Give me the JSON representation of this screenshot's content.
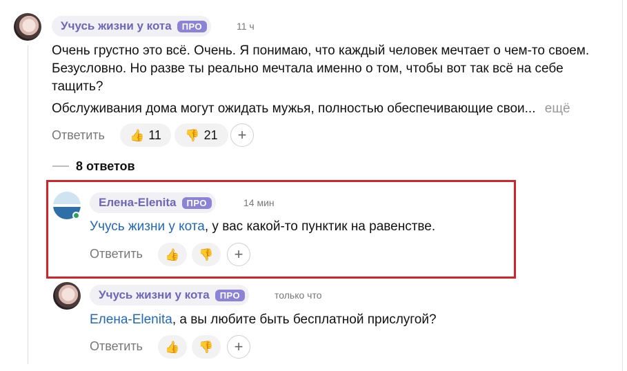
{
  "comment": {
    "author": "Учусь жизни у кота",
    "badge": "ПРО",
    "time": "11 ч",
    "paragraph1": "Очень грустно это всё. Очень. Я понимаю, что каждый человек мечтает о чем-то своем. Безусловно. Но разве ты реально мечтала именно о том, чтобы вот так всё на себе тащить?",
    "paragraph2": "Обслуживания дома могут ожидать мужья, полностью обеспечивающие свои...",
    "more_label": "ещё",
    "reply_label": "Ответить",
    "likes": "11",
    "dislikes": "21"
  },
  "replies_count_label": "8 ответов",
  "replies": [
    {
      "author": "Елена-Elenita",
      "badge": "ПРО",
      "time": "14 мин",
      "mention": "Учусь жизни у кота",
      "text": ", у вас какой-то пунктик на равенстве.",
      "reply_label": "Ответить"
    },
    {
      "author": "Учусь жизни у кота",
      "badge": "ПРО",
      "time": "только что",
      "mention": "Елена-Elenita",
      "text": ", а вы любите быть бесплатной прислугой?",
      "reply_label": "Ответить"
    }
  ],
  "icons": {
    "like": "thumbs-up-icon",
    "dislike": "thumbs-down-icon",
    "add": "plus-icon"
  },
  "colors": {
    "author": "#6e66b8",
    "pro_badge": "#8b83d6",
    "mention": "#2268b8",
    "highlight": "#d2232a",
    "online": "#26a65b"
  }
}
